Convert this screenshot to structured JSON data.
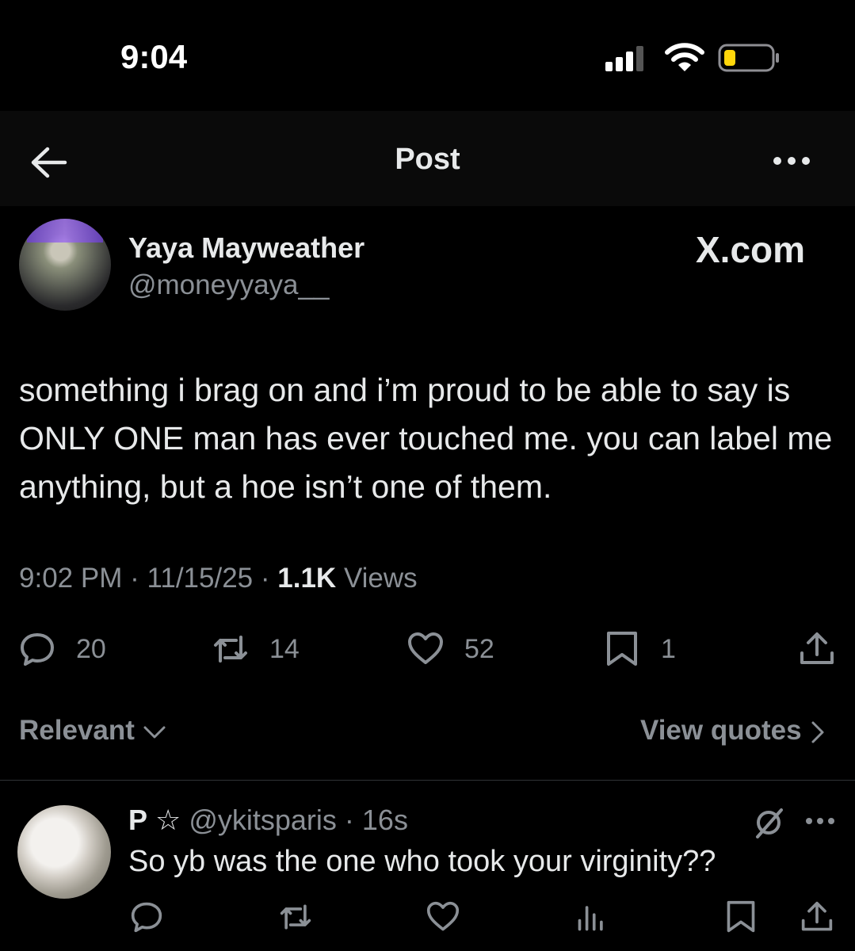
{
  "status_bar": {
    "time": "9:04"
  },
  "header": {
    "title": "Post"
  },
  "post": {
    "author_name": "Yaya Mayweather",
    "author_handle": "@moneyyaya__",
    "watermark": "X.com",
    "text": "something i brag on and i’m proud to be able to say is ONLY ONE man has ever touched me. you can label me anything, but a hoe isn’t one of them.",
    "time": "9:02 PM",
    "date": "11/15/25",
    "views_count": "1.1K",
    "views_label": "Views",
    "replies": "20",
    "reposts": "14",
    "likes": "52",
    "bookmarks": "1"
  },
  "filters": {
    "sort_label": "Relevant",
    "quotes_label": "View quotes"
  },
  "reply": {
    "name": "P",
    "badge": "☆",
    "handle": "@ykitsparis",
    "age": "16s",
    "text": "So yb was the one who took your virginity??"
  },
  "colors": {
    "background": "#000000",
    "text": "#e7e9ea",
    "muted": "#8b9096",
    "divider": "#2f3336"
  }
}
